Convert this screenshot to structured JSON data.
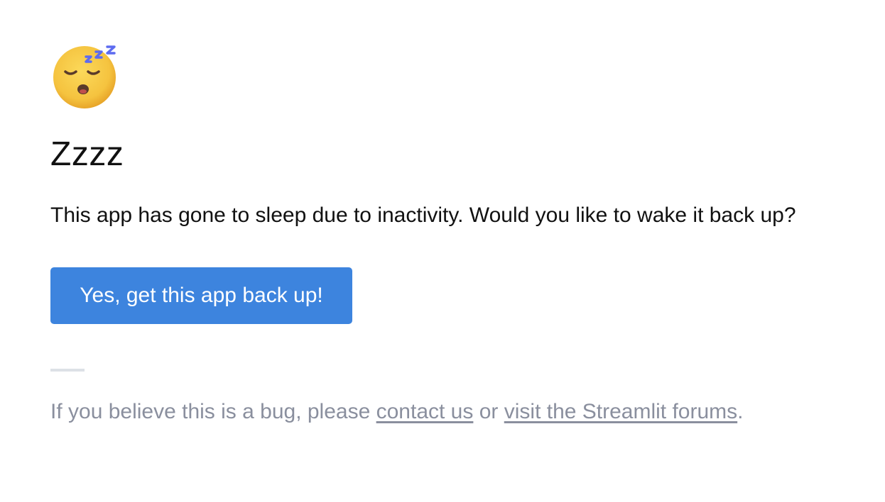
{
  "icon": {
    "name": "sleeping-face-emoji",
    "zzz": "z z z",
    "colors": {
      "face": "#f7c948",
      "face_shade": "#e9a92b",
      "eyes_mouth": "#5a3b2a",
      "zzz": "#5d6bf0"
    }
  },
  "title": "Zzzz",
  "message": "This app has gone to sleep due to inactivity. Would you like to wake it back up?",
  "wake_button": {
    "label": "Yes, get this app back up!",
    "color": "#3d84de"
  },
  "footer": {
    "prefix": "If you believe this is a bug, please ",
    "contact_link": "contact us",
    "middle": " or ",
    "forums_link": "visit the Streamlit forums",
    "suffix": "."
  }
}
